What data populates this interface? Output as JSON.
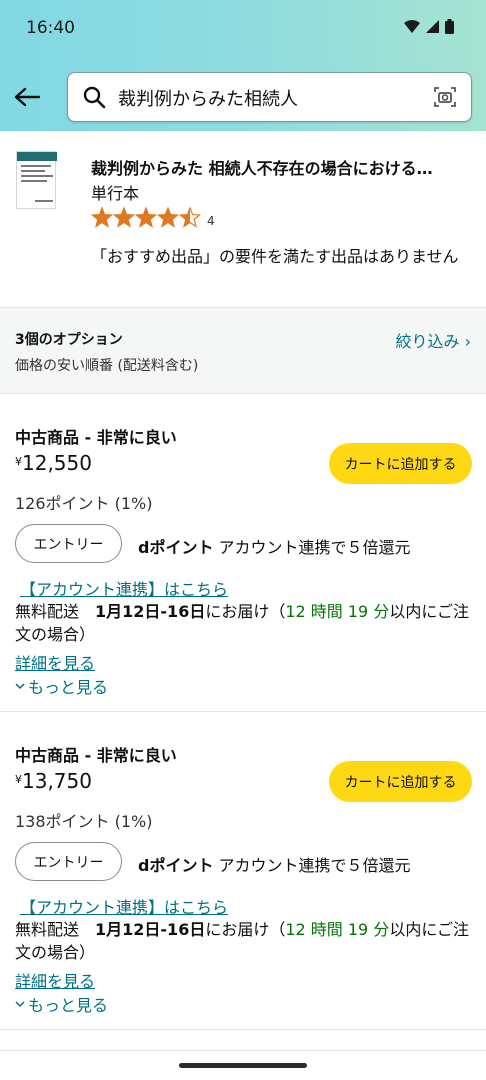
{
  "status_bar": {
    "time": "16:40"
  },
  "search": {
    "query": "裁判例からみた相続人"
  },
  "product": {
    "title": "裁判例からみた 相続人不存在の場合における…",
    "format": "単行本",
    "rating_count": "4",
    "note": "「おすすめ出品」の要件を満たす出品はありません"
  },
  "options": {
    "count_label": "3個のオプション",
    "sort_label": "価格の安い順番 (配送料含む)",
    "filter_label": "絞り込み ›"
  },
  "offers": [
    {
      "condition": "中古商品 - 非常に良い",
      "currency": "¥",
      "price": "12,550",
      "points": "126ポイント (1%)",
      "cart_label": "カートに追加する",
      "entry_label": "エントリー",
      "dpoint_bold": "dポイント",
      "dpoint_text": " アカウント連携で５倍還元",
      "account_link": "【アカウント連携】はこちら",
      "delivery_prefix": "無料配送　",
      "delivery_date": "1月12日-16日",
      "delivery_mid": "にお届け（",
      "delivery_time": "12 時間 19 分",
      "delivery_suffix": "以内にご注文の場合）",
      "details_label": "詳細を見る",
      "more_label": "もっと見る"
    },
    {
      "condition": "中古商品 - 非常に良い",
      "currency": "¥",
      "price": "13,750",
      "points": "138ポイント (1%)",
      "cart_label": "カートに追加する",
      "entry_label": "エントリー",
      "dpoint_bold": "dポイント",
      "dpoint_text": " アカウント連携で５倍還元",
      "account_link": "【アカウント連携】はこちら",
      "delivery_prefix": "無料配送　",
      "delivery_date": "1月12日-16日",
      "delivery_mid": "にお届け（",
      "delivery_time": "12 時間 19 分",
      "delivery_suffix": "以内にご注文の場合）",
      "details_label": "詳細を見る",
      "more_label": "もっと見る"
    }
  ],
  "colors": {
    "accent_link": "#007185",
    "cart_button": "#ffd814",
    "star": "#de7921",
    "green": "#007600"
  },
  "rating_stars": 4.5
}
